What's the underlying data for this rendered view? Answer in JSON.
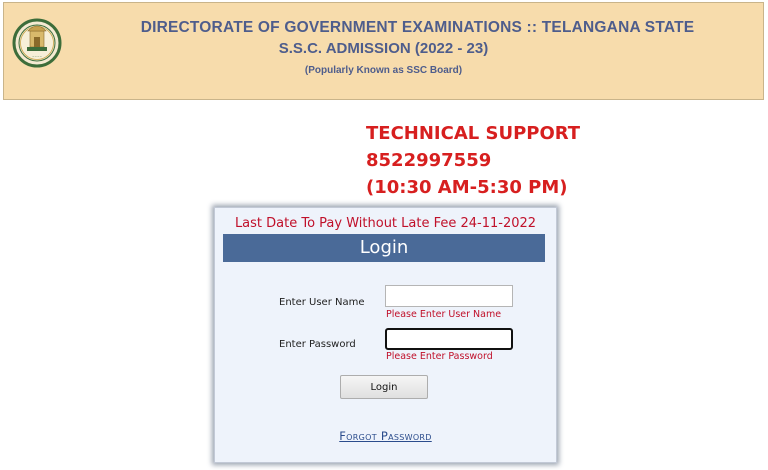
{
  "header": {
    "line1": "DIRECTORATE OF GOVERNMENT EXAMINATIONS :: TELANGANA STATE",
    "line2": "S.S.C. ADMISSION (2022 - 23)",
    "line3": "(Popularly Known as SSC Board)",
    "emblem_icon": "telangana-emblem-icon"
  },
  "support": {
    "title": "TECHNICAL SUPPORT",
    "phone": "8522997559",
    "hours": "(10:30 AM-5:30 PM)"
  },
  "login": {
    "notice": "Last Date To Pay Without Late Fee 24-11-2022",
    "heading": "Login",
    "username_label": "Enter User Name",
    "username_value": "",
    "username_error": "Please Enter User Name",
    "password_label": "Enter Password",
    "password_value": "",
    "password_error": "Please Enter Password",
    "button_label": "Login",
    "forgot_link": "Forgot Password"
  },
  "colors": {
    "header_bg": "#f7dcac",
    "header_text": "#4e5d8c",
    "support_text": "#d71f1f",
    "login_bar": "#4a6a98",
    "error_text": "#c0102a",
    "link": "#2b4c8c"
  }
}
